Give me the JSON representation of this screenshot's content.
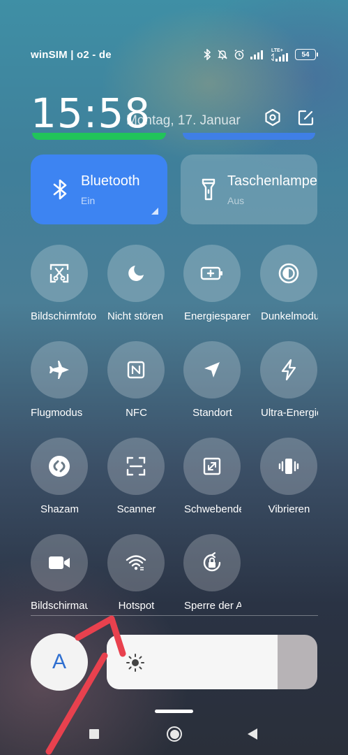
{
  "status_bar": {
    "carrier": "winSIM | o2 - de",
    "network_type": "LTE+",
    "battery_level": "54",
    "icons": [
      "bluetooth-icon",
      "mute-icon",
      "alarm-icon",
      "signal-icon",
      "signal-icon",
      "battery-icon"
    ]
  },
  "header": {
    "time": "15:58",
    "date": "Montag, 17. Januar"
  },
  "big_tiles": [
    {
      "title": "Bluetooth",
      "status": "Ein",
      "icon": "bluetooth-icon",
      "color": "#3d84f2"
    },
    {
      "title": "Taschenlampe",
      "status": "Aus",
      "icon": "flashlight-icon"
    }
  ],
  "tiles": [
    {
      "label": "Bildschirmfoto",
      "icon": "screenshot-icon"
    },
    {
      "label": "Nicht stören",
      "icon": "moon-icon"
    },
    {
      "label": "Energiesparen",
      "icon": "battery-saver-icon"
    },
    {
      "label": "Dunkelmodus",
      "icon": "dark-mode-icon"
    },
    {
      "label": "Flugmodus",
      "icon": "airplane-icon"
    },
    {
      "label": "NFC",
      "icon": "nfc-icon"
    },
    {
      "label": "Standort",
      "icon": "location-icon"
    },
    {
      "label": "Ultra-Energiesparen",
      "icon": "lightning-icon"
    },
    {
      "label": "Shazam",
      "icon": "shazam-icon"
    },
    {
      "label": "Scanner",
      "icon": "scanner-icon"
    },
    {
      "label": "Schwebendes Fenster",
      "icon": "floating-window-icon"
    },
    {
      "label": "Vibrieren",
      "icon": "vibrate-icon"
    },
    {
      "label": "Bildschirmaufnahme",
      "icon": "screen-recorder-icon"
    },
    {
      "label": "Hotspot",
      "icon": "hotspot-icon"
    },
    {
      "label": "Sperre der Ausrichtung",
      "icon": "rotation-lock-icon"
    }
  ],
  "brightness": {
    "auto_label": "A",
    "level_fraction": 0.81
  },
  "colors": {
    "accent_blue": "#3d84f2",
    "bar_green": "#21c45a",
    "bar_blue": "#3f7fe6",
    "annotation_red": "#e8414e"
  }
}
